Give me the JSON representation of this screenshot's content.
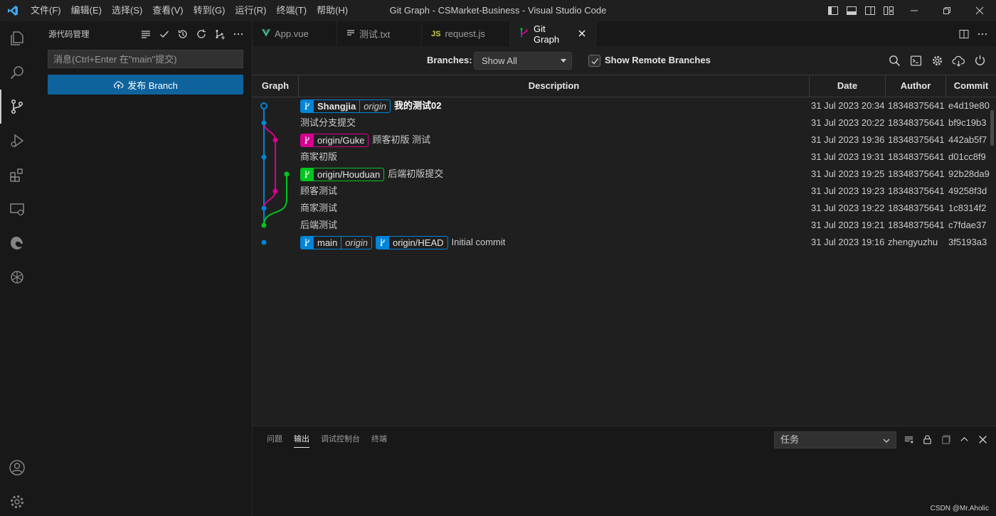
{
  "window": {
    "title": "Git Graph - CSMarket-Business - Visual Studio Code",
    "menu": [
      "文件(F)",
      "编辑(E)",
      "选择(S)",
      "查看(V)",
      "转到(G)",
      "运行(R)",
      "终端(T)",
      "帮助(H)"
    ]
  },
  "sidebar": {
    "title": "源代码管理",
    "message_placeholder": "消息(Ctrl+Enter 在\"main\"提交)",
    "publish_label": "发布 Branch"
  },
  "tabs": [
    {
      "icon": "vue-icon",
      "label": "App.vue"
    },
    {
      "icon": "text-file-icon",
      "label": "测试.txt"
    },
    {
      "icon": "js-icon",
      "icon_text": "JS",
      "label": "request.js"
    },
    {
      "icon": "git-graph-icon",
      "label": "Git Graph",
      "active": true
    }
  ],
  "controls": {
    "branches_label": "Branches:",
    "branches_value": "Show All",
    "show_remote_label": "Show Remote Branches",
    "show_remote_checked": true
  },
  "table": {
    "headers": {
      "graph": "Graph",
      "description": "Description",
      "date": "Date",
      "author": "Author",
      "commit": "Commit"
    },
    "commits": [
      {
        "refs": [
          {
            "name": "Shangjia",
            "remote": "origin",
            "color": "#0085d9"
          }
        ],
        "message": "我的测试02",
        "bold": true,
        "date": "31 Jul 2023 20:34",
        "author": "18348375641",
        "hash": "e4d19e80"
      },
      {
        "refs": [],
        "message": "测试分支提交",
        "date": "31 Jul 2023 20:22",
        "author": "18348375641",
        "hash": "bf9c19b3"
      },
      {
        "refs": [
          {
            "name": "origin/Guke",
            "color": "#d9008f"
          }
        ],
        "message": "顾客初版 测试",
        "date": "31 Jul 2023 19:36",
        "author": "18348375641",
        "hash": "442ab5f7"
      },
      {
        "refs": [],
        "message": "商家初版",
        "date": "31 Jul 2023 19:31",
        "author": "18348375641",
        "hash": "d01cc8f9"
      },
      {
        "refs": [
          {
            "name": "origin/Houduan",
            "color": "#00c61f"
          }
        ],
        "message": "后端初版提交",
        "date": "31 Jul 2023 19:25",
        "author": "18348375641",
        "hash": "92b28da9"
      },
      {
        "refs": [],
        "message": "顾客测试",
        "date": "31 Jul 2023 19:23",
        "author": "18348375641",
        "hash": "49258f3d"
      },
      {
        "refs": [],
        "message": "商家测试",
        "date": "31 Jul 2023 19:22",
        "author": "18348375641",
        "hash": "1c8314f2"
      },
      {
        "refs": [],
        "message": "后端测试",
        "date": "31 Jul 2023 19:21",
        "author": "18348375641",
        "hash": "c7fdae37"
      },
      {
        "refs": [
          {
            "name": "main",
            "remote": "origin",
            "color": "#0085d9"
          },
          {
            "name": "origin/HEAD",
            "color": "#0085d9"
          }
        ],
        "message": "Initial commit",
        "date": "31 Jul 2023 19:16",
        "author": "zhengyuzhu",
        "hash": "3f5193a3"
      }
    ]
  },
  "panel": {
    "tabs": [
      "问题",
      "输出",
      "调试控制台",
      "终端"
    ],
    "active_tab": "输出",
    "task_select": "任务"
  },
  "watermark": "CSDN @Mr.Aholic",
  "colors": {
    "blue": "#0085d9",
    "magenta": "#d9008f",
    "green": "#00c61f",
    "accent": "#0e639c"
  }
}
